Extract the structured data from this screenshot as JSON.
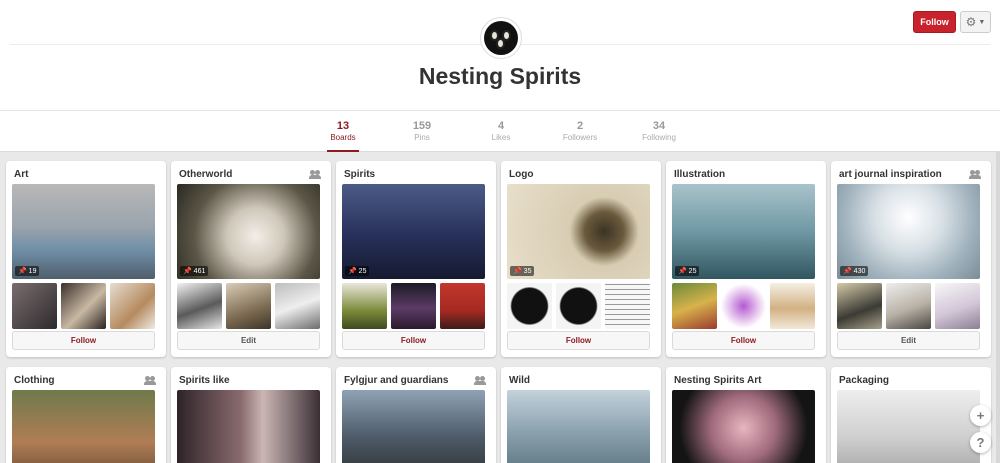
{
  "profile": {
    "name": "Nesting Spirits"
  },
  "header": {
    "follow_label": "Follow"
  },
  "stats": [
    {
      "value": "13",
      "label": "Boards"
    },
    {
      "value": "159",
      "label": "Pins"
    },
    {
      "value": "4",
      "label": "Likes"
    },
    {
      "value": "2",
      "label": "Followers"
    },
    {
      "value": "34",
      "label": "Following"
    }
  ],
  "boards_row1": [
    {
      "title": "Art",
      "pins": "19",
      "action": "Follow",
      "group": false
    },
    {
      "title": "Otherworld",
      "pins": "461",
      "action": "Edit",
      "group": true
    },
    {
      "title": "Spirits",
      "pins": "25",
      "action": "Follow",
      "group": false
    },
    {
      "title": "Logo",
      "pins": "35",
      "action": "Follow",
      "group": false
    },
    {
      "title": "Illustration",
      "pins": "25",
      "action": "Follow",
      "group": false
    },
    {
      "title": "art journal inspiration",
      "pins": "430",
      "action": "Edit",
      "group": true
    }
  ],
  "boards_row2": [
    {
      "title": "Clothing",
      "group": true
    },
    {
      "title": "Spirits like",
      "group": false
    },
    {
      "title": "Fylgjur and guardians",
      "group": true
    },
    {
      "title": "Wild",
      "group": false
    },
    {
      "title": "Nesting Spirits Art",
      "group": false
    },
    {
      "title": "Packaging",
      "group": false
    }
  ],
  "icons": {
    "gear": "gear-icon",
    "add": "plus-icon",
    "help": "question-icon"
  },
  "colors": {
    "accent": "#c8232c",
    "active_stat": "#8c1c24"
  }
}
